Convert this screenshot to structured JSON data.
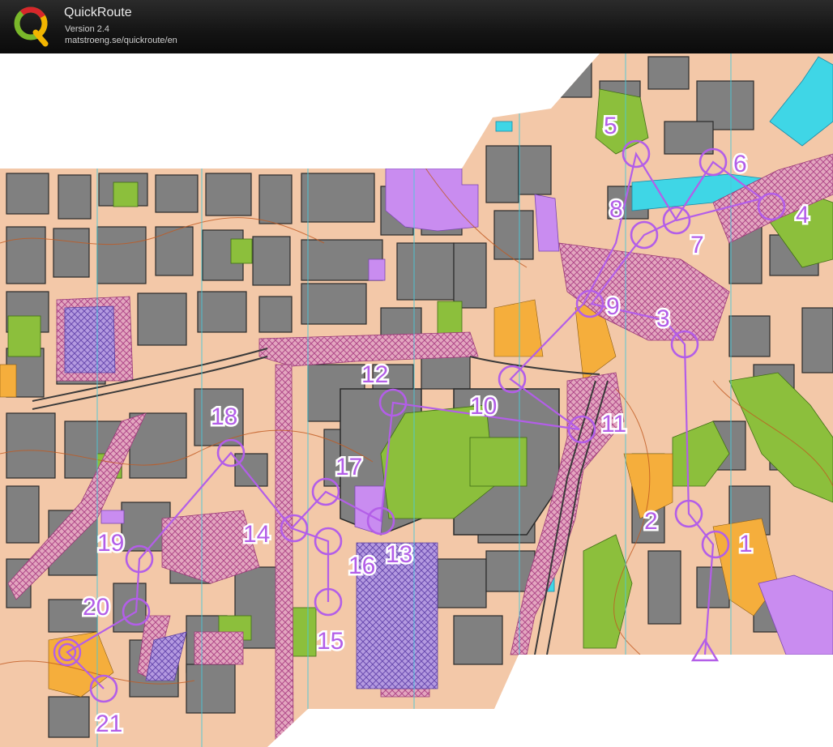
{
  "app": {
    "title": "QuickRoute",
    "version": "Version 2.4",
    "url": "matstroeng.se/quickroute/en"
  },
  "colors": {
    "course": "#b35ee8",
    "paved": "#f3c8a8",
    "building": "#808080",
    "green": "#8cbf3c",
    "purple_area": "#c98cf0",
    "water": "#3fd6e6",
    "yellow": "#f5ae3c",
    "contour": "#c0591f"
  },
  "map": {
    "controls": [
      {
        "label": "1"
      },
      {
        "label": "2"
      },
      {
        "label": "3"
      },
      {
        "label": "4"
      },
      {
        "label": "5"
      },
      {
        "label": "6"
      },
      {
        "label": "7"
      },
      {
        "label": "8"
      },
      {
        "label": "9"
      },
      {
        "label": "10"
      },
      {
        "label": "11"
      },
      {
        "label": "12"
      },
      {
        "label": "13"
      },
      {
        "label": "14"
      },
      {
        "label": "15"
      },
      {
        "label": "16"
      },
      {
        "label": "17"
      },
      {
        "label": "18"
      },
      {
        "label": "19"
      },
      {
        "label": "20"
      },
      {
        "label": "21"
      }
    ]
  }
}
